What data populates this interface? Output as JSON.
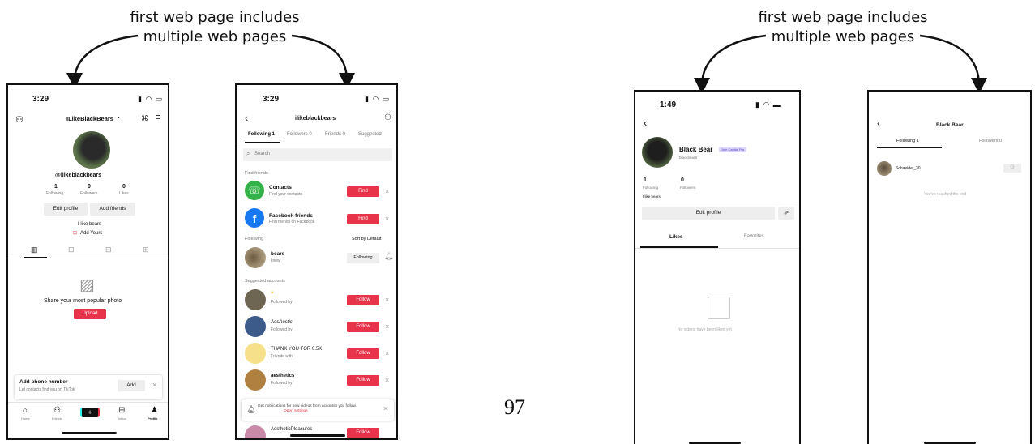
{
  "captions": {
    "left": "first web page includes\nmultiple web pages",
    "right": "first web page includes\nmultiple web pages"
  },
  "page_number": "97",
  "phone1": {
    "time": "3:29",
    "username": "ILikeBlackBears",
    "handle": "@ilikeblackbears",
    "stats": [
      {
        "value": "1",
        "label": "Following"
      },
      {
        "value": "0",
        "label": "Followers"
      },
      {
        "value": "0",
        "label": "Likes"
      }
    ],
    "edit_profile": "Edit profile",
    "add_friends": "Add friends",
    "bio": "I like bears",
    "add_yours": "Add Yours",
    "empty_title": "Share your most popular photo",
    "upload": "Upload",
    "phone_prompt_title": "Add phone number",
    "phone_prompt_sub": "Let contacts find you on TikTok",
    "add": "Add",
    "nav": [
      "Home",
      "Friends",
      "",
      "Inbox",
      "Profile"
    ]
  },
  "phone2": {
    "time": "3:29",
    "title": "ilikeblackbears",
    "tabs": [
      "Following 1",
      "Followers 0",
      "Friends 0",
      "Suggested"
    ],
    "search_placeholder": "Search",
    "find_friends": "Find friends",
    "contacts_title": "Contacts",
    "contacts_sub": "Find your contacts",
    "facebook_title": "Facebook friends",
    "facebook_sub": "Find friends on Facebook",
    "find": "Find",
    "following_header": "Following",
    "sort": "Sort by Default",
    "following_name": "bears",
    "following_sub": "knew",
    "following_btn": "Following",
    "suggested_header": "Suggested accounts",
    "suggested": [
      {
        "name": "",
        "sub": "Followed by"
      },
      {
        "name": "AesAestic",
        "sub": "Followed by"
      },
      {
        "name": "THANK YOU FOR 0.5K",
        "sub": "Friends with"
      },
      {
        "name": "aesthetics",
        "sub": "Followed by"
      }
    ],
    "follow": "Follow",
    "notif_text": "Get notifications for new videos from accounts you follow.",
    "notif_link": "Open settings",
    "last_name": "AestheticPleasures"
  },
  "phone3": {
    "time": "1:49",
    "name": "Black Bear",
    "badge": "Join Capital Pro",
    "handle": "blackbear8",
    "stats": [
      {
        "value": "1",
        "label": "Following"
      },
      {
        "value": "0",
        "label": "Followers"
      }
    ],
    "bio": "I like bears",
    "edit_profile": "Edit profile",
    "tabs": [
      "Likes",
      "Favorites"
    ],
    "empty": "No videos have been liked yet"
  },
  "phone4": {
    "title": "Black Bear",
    "tabs": [
      "Following 1",
      "Followers 0"
    ],
    "user": "Schaeide _30",
    "end": "You've reached the end"
  },
  "colors": {
    "red": "#e8344b",
    "green": "#34b24a",
    "facebook": "#1877f2"
  }
}
